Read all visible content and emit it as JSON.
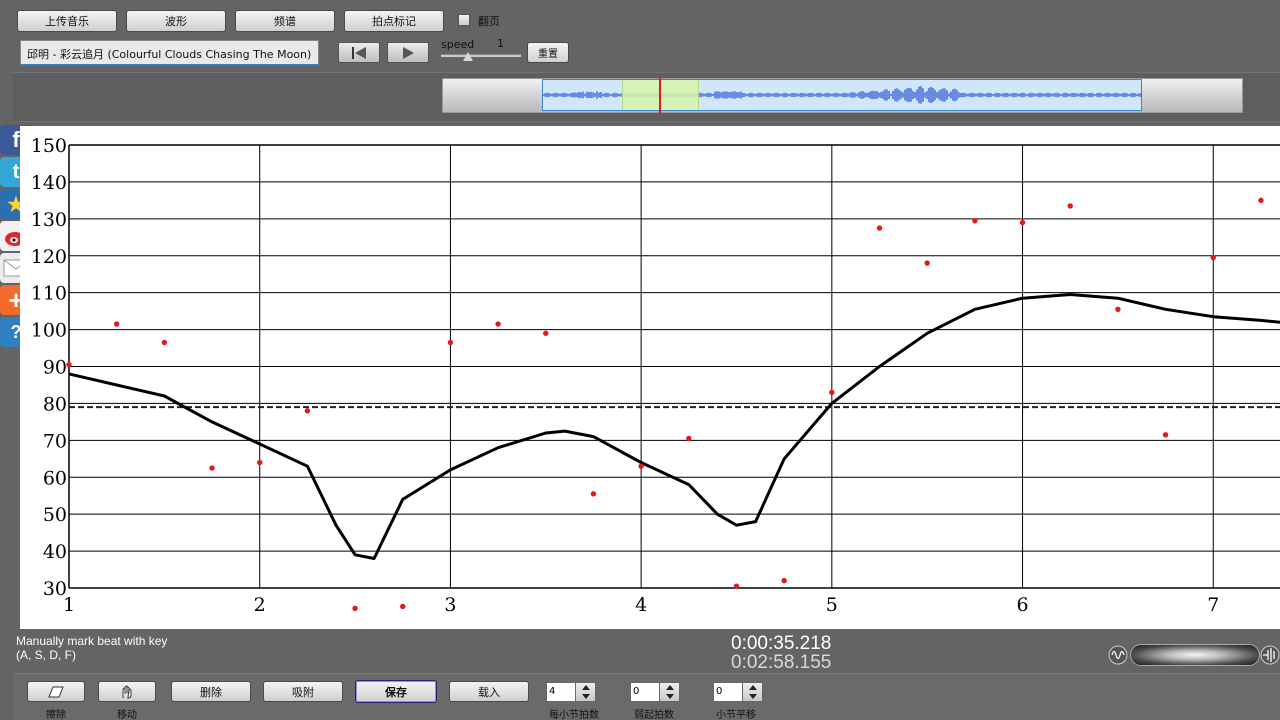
{
  "toolbar": {
    "upload_label": "上传音乐",
    "waveform_label": "波形",
    "spectrum_label": "频谱",
    "beat_mark_label": "拍点标记",
    "page_flip_label": "翻页",
    "page_flip_checked": false
  },
  "track": {
    "title": "邱明 - 彩云追月 (Colourful Clouds Chasing The Moon)"
  },
  "playback": {
    "speed_label": "speed",
    "speed_value": "1",
    "reset_label": "重置",
    "prev_icon": "skip-back-icon",
    "play_icon": "play-icon"
  },
  "social": [
    "facebook-icon",
    "twitter-icon",
    "favorite-star-icon",
    "weibo-icon",
    "mail-icon",
    "add-plus-icon",
    "help-icon"
  ],
  "status": {
    "hint_line1": "Manually mark beat with key",
    "hint_line2": "(A, S, D, F)",
    "current_time": "0:00:35.218",
    "total_time": "0:02:58.155"
  },
  "bottom": {
    "erase_caption": "擦除",
    "move_caption": "移动",
    "delete_label": "删除",
    "snap_label": "吸附",
    "save_label": "保存",
    "load_label": "载入",
    "beats_per_bar_value": "4",
    "beats_per_bar_caption": "每小节拍数",
    "pickup_value": "0",
    "pickup_caption": "弱起拍数",
    "bar_offset_value": "0",
    "bar_offset_caption": "小节平移"
  },
  "colors": {
    "point": "#e21a1a",
    "curve": "#000000",
    "grid": "#000000",
    "waveform": "#3f63d6",
    "window": "#d6f5aa"
  },
  "chart_data": {
    "type": "scatter",
    "title": "",
    "xlabel": "",
    "ylabel": "",
    "xlim": [
      1,
      7.35
    ],
    "ylim": [
      30,
      150
    ],
    "x_ticks": [
      1,
      2,
      3,
      4,
      5,
      6,
      7
    ],
    "y_ticks": [
      30,
      40,
      50,
      60,
      70,
      80,
      90,
      100,
      110,
      120,
      130,
      140,
      150
    ],
    "grid": true,
    "average_line": 79,
    "points": [
      [
        1.0,
        90.5
      ],
      [
        1.25,
        101.5
      ],
      [
        1.5,
        96.5
      ],
      [
        1.75,
        62.5
      ],
      [
        2.0,
        64.0
      ],
      [
        2.25,
        78.0
      ],
      [
        2.5,
        24.5
      ],
      [
        2.75,
        25.0
      ],
      [
        3.0,
        96.5
      ],
      [
        3.25,
        101.5
      ],
      [
        3.5,
        99.0
      ],
      [
        3.75,
        55.5
      ],
      [
        4.0,
        63.0
      ],
      [
        4.25,
        70.5
      ],
      [
        4.5,
        30.5
      ],
      [
        4.75,
        32.0
      ],
      [
        5.0,
        83.0
      ],
      [
        5.25,
        127.5
      ],
      [
        5.5,
        118.0
      ],
      [
        5.75,
        129.5
      ],
      [
        6.0,
        129.0
      ],
      [
        6.25,
        133.5
      ],
      [
        6.5,
        105.5
      ],
      [
        6.75,
        71.5
      ],
      [
        7.0,
        119.5
      ],
      [
        7.25,
        135.0
      ]
    ],
    "curve": [
      [
        1.0,
        88
      ],
      [
        1.25,
        85
      ],
      [
        1.5,
        82
      ],
      [
        1.75,
        75
      ],
      [
        2.0,
        69
      ],
      [
        2.25,
        63
      ],
      [
        2.4,
        47
      ],
      [
        2.5,
        39
      ],
      [
        2.6,
        38
      ],
      [
        2.75,
        54
      ],
      [
        3.0,
        62
      ],
      [
        3.25,
        68
      ],
      [
        3.5,
        72
      ],
      [
        3.6,
        72.5
      ],
      [
        3.75,
        71
      ],
      [
        4.0,
        64
      ],
      [
        4.25,
        58
      ],
      [
        4.4,
        50
      ],
      [
        4.5,
        47
      ],
      [
        4.6,
        48
      ],
      [
        4.75,
        65
      ],
      [
        5.0,
        80
      ],
      [
        5.25,
        90
      ],
      [
        5.5,
        99
      ],
      [
        5.75,
        105.5
      ],
      [
        6.0,
        108.5
      ],
      [
        6.25,
        109.5
      ],
      [
        6.5,
        108.5
      ],
      [
        6.75,
        105.5
      ],
      [
        7.0,
        103.5
      ],
      [
        7.25,
        102.5
      ],
      [
        7.35,
        102
      ]
    ]
  }
}
